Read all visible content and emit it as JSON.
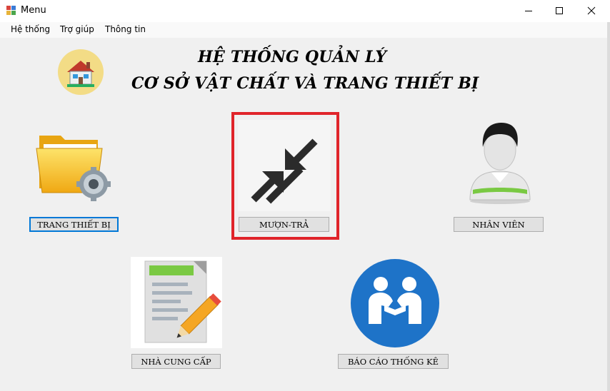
{
  "window": {
    "title": "Menu"
  },
  "menubar": {
    "items": [
      "Hệ thống",
      "Trợ giúp",
      "Thông tin"
    ]
  },
  "header": {
    "line1": "HỆ THỐNG QUẢN LÝ",
    "line2": "CƠ SỞ VẬT CHẤT VÀ TRANG THIẾT BỊ"
  },
  "modules": {
    "trang_thiet_bi": "TRANG THIẾT BỊ",
    "muon_tra": "MƯỢN-TRẢ",
    "nhan_vien": "NHÂN VIÊN",
    "nha_cung_cap": "NHÀ CUNG CẤP",
    "bao_cao": "BÁO CÁO THỐNG KÊ"
  },
  "colors": {
    "highlight": "#e0242a",
    "focus": "#0078d7",
    "report_circle": "#1e73c8"
  }
}
